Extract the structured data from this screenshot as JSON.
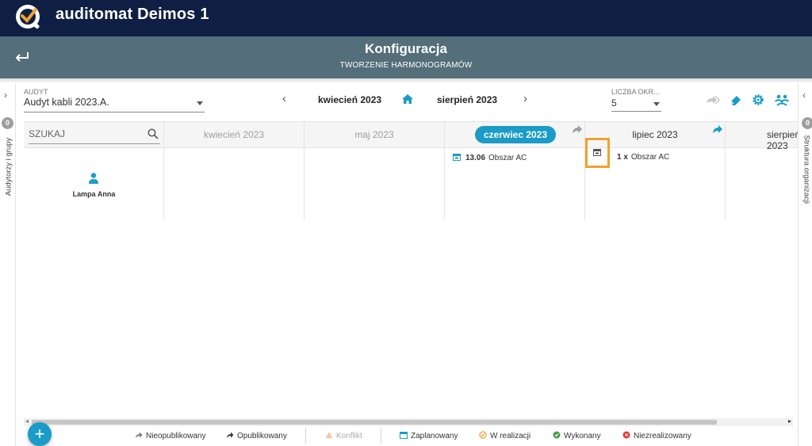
{
  "app": {
    "name": "auditomat Deimos 1"
  },
  "header": {
    "title": "Konfiguracja",
    "subtitle": "TWORZENIE HARMONOGRAMÓW"
  },
  "sidebar_left": {
    "badge": "0",
    "label": "Audytorzy i grupy"
  },
  "sidebar_right": {
    "badge": "0",
    "label": "Struktura organizacji"
  },
  "audit": {
    "label": "AUDYT",
    "value": "Audyt kabli 2023.A."
  },
  "nav": {
    "from": "kwiecień 2023",
    "to": "sierpień 2023"
  },
  "count": {
    "label": "LICZBA OKR...",
    "value": "5"
  },
  "search": {
    "placeholder": "SZUKAJ"
  },
  "months": [
    {
      "label": "kwiecień 2023"
    },
    {
      "label": "maj 2023"
    },
    {
      "label": "czerwiec 2023"
    },
    {
      "label": "lipiec 2023"
    },
    {
      "label": "sierpień 2023"
    }
  ],
  "row": {
    "name": "Lampa Anna",
    "entries": [
      {
        "date": "13.06",
        "area": "Obszar AC"
      },
      {
        "qty": "1 x",
        "area": "Obszar AC"
      }
    ]
  },
  "legend": [
    {
      "label": "Nieopublikowany"
    },
    {
      "label": "Opublikowany"
    },
    {
      "label": "Konflikt"
    },
    {
      "label": "Zaplanowany"
    },
    {
      "label": "W realizacji"
    },
    {
      "label": "Wykonany"
    },
    {
      "label": "Niezrealizowany"
    }
  ],
  "colors": {
    "topbar": "#0e1f43",
    "header": "#546e7a",
    "accent": "#1a9bc8",
    "highlight": "#f0a12e"
  }
}
